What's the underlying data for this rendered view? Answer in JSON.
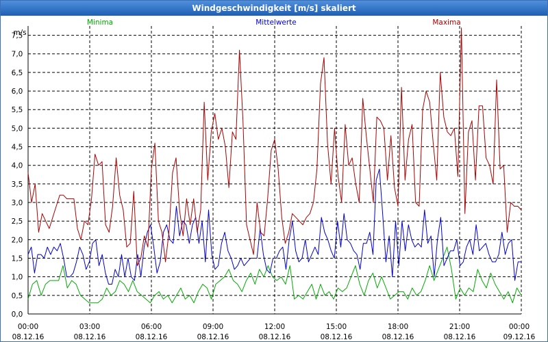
{
  "window": {
    "title": "Windgeschwindigkeit [m/s] skaliert"
  },
  "colors": {
    "title_bar": "#2b6cc4",
    "min": "#00aa00",
    "avg": "#0000cc",
    "max": "#aa0000",
    "grid": "#000000"
  },
  "chart_data": {
    "type": "line",
    "title": "Windgeschwindigkeit [m/s] skaliert",
    "ylabel": "m/s",
    "xlabel": "",
    "ylim": [
      0,
      7.75
    ],
    "y_ticks": [
      "0,0",
      "0,5",
      "1,0",
      "1,5",
      "2,0",
      "2,5",
      "3,0",
      "3,5",
      "4,0",
      "4,5",
      "5,0",
      "5,5",
      "6,0",
      "6,5",
      "7,0",
      "7,5"
    ],
    "x_range": [
      "2016-12-08 00:00",
      "2016-12-09 00:00"
    ],
    "x_ticks": [
      {
        "time": "00:00",
        "date": "08.12.16"
      },
      {
        "time": "03:00",
        "date": "08.12.16"
      },
      {
        "time": "06:00",
        "date": "08.12.16"
      },
      {
        "time": "09:00",
        "date": "08.12.16"
      },
      {
        "time": "12:00",
        "date": "08.12.16"
      },
      {
        "time": "15:00",
        "date": "08.12.16"
      },
      {
        "time": "18:00",
        "date": "08.12.16"
      },
      {
        "time": "21:00",
        "date": "08.12.16"
      },
      {
        "time": "00:00",
        "date": "09.12.16"
      }
    ],
    "grid": true,
    "x_interval_minutes": 15,
    "series": [
      {
        "name": "Minima",
        "color": "#00aa00",
        "values": [
          0.4,
          0.8,
          0.9,
          0.5,
          0.8,
          0.9,
          0.9,
          0.9,
          1.3,
          0.7,
          0.9,
          0.8,
          0.5,
          0.4,
          0.3,
          0.3,
          0.3,
          0.4,
          0.7,
          0.5,
          0.6,
          0.9,
          0.8,
          0.6,
          0.9,
          0.6,
          0.5,
          0.4,
          0.3,
          0.5,
          0.6,
          0.4,
          0.5,
          0.3,
          0.5,
          0.7,
          0.4,
          0.5,
          0.3,
          0.6,
          0.8,
          0.7,
          0.4,
          0.8,
          0.9,
          1.0,
          1.2,
          0.9,
          0.8,
          0.6,
          0.9,
          1.1,
          0.8,
          1.2,
          1.0,
          1.3,
          1.0,
          0.9,
          1.0,
          0.8,
          1.3,
          0.4,
          0.5,
          0.4,
          0.6,
          0.8,
          0.4,
          0.8,
          0.5,
          0.6,
          0.4,
          0.7,
          0.6,
          0.7,
          1.0,
          1.3,
          0.8,
          0.5,
          0.9,
          1.1,
          0.7,
          1.0,
          0.7,
          0.4,
          0.5,
          0.6,
          0.6,
          0.4,
          0.7,
          0.5,
          0.6,
          0.9,
          1.3,
          0.9,
          1.2,
          1.5,
          1.8,
          1.2,
          0.4,
          0.7,
          0.5,
          0.7,
          0.6,
          1.2,
          0.9,
          0.7,
          1.1,
          0.8,
          0.6,
          0.4,
          0.6,
          0.3,
          0.7,
          0.5
        ]
      },
      {
        "name": "Mittelwerte",
        "color": "#0000cc",
        "values": [
          1.6,
          1.8,
          1.1,
          1.6,
          1.6,
          1.5,
          1.8,
          1.6,
          1.8,
          1.7,
          1.9,
          1.5,
          1.0,
          1.0,
          1.1,
          1.4,
          1.8,
          1.6,
          1.2,
          1.4,
          1.9,
          2.0,
          1.3,
          1.6,
          1.1,
          0.8,
          0.8,
          1.2,
          1.0,
          1.6,
          1.0,
          1.5,
          1.0,
          0.9,
          1.6,
          1.0,
          1.8,
          2.2,
          2.4,
          1.8,
          1.1,
          1.4,
          2.2,
          2.4,
          2.0,
          1.9,
          2.9,
          2.1,
          2.5,
          2.4,
          1.9,
          2.4,
          2.6,
          1.9,
          2.5,
          1.4,
          2.8,
          1.6,
          1.2,
          1.3,
          1.9,
          2.2,
          1.7,
          1.5,
          1.2,
          1.3,
          1.5,
          1.3,
          1.4,
          1.5,
          1.5,
          1.5,
          2.3,
          1.6,
          1.2,
          1.1,
          1.5,
          1.5,
          1.7,
          1.8,
          1.2,
          2.0,
          2.5,
          1.7,
          1.4,
          1.5,
          2.0,
          1.4,
          1.6,
          1.8,
          1.6,
          2.6,
          2.2,
          2.0,
          1.7,
          1.5,
          2.5,
          1.8,
          2.7,
          2.0,
          1.9,
          1.7,
          1.6,
          1.2,
          1.9,
          1.9,
          2.2,
          1.6,
          3.6,
          3.9,
          2.7,
          1.4,
          2.1,
          1.0,
          2.5,
          1.3,
          2.5,
          1.7,
          2.4,
          2.0,
          1.8,
          1.9,
          1.8,
          2.8,
          1.9,
          2.1,
          1.0,
          2.0,
          2.6,
          1.3,
          1.5,
          1.7,
          1.7,
          2.0,
          1.3,
          1.4,
          1.8,
          2.0,
          1.6,
          2.4,
          1.7,
          1.8,
          1.9,
          1.6,
          1.4,
          1.4,
          1.6,
          2.2,
          1.6,
          1.9,
          2.0,
          0.9,
          1.4,
          1.4
        ]
      },
      {
        "name": "Maxima",
        "color": "#aa0000",
        "values": [
          3.8,
          3.0,
          3.5,
          2.2,
          2.7,
          2.5,
          2.3,
          2.6,
          2.9,
          3.2,
          3.2,
          3.1,
          3.1,
          3.1,
          2.3,
          2.0,
          2.5,
          2.4,
          3.1,
          4.3,
          4.0,
          4.1,
          2.4,
          2.2,
          2.9,
          4.2,
          3.2,
          2.8,
          1.8,
          1.9,
          3.3,
          1.3,
          1.5,
          2.1,
          1.8,
          3.9,
          4.6,
          2.5,
          2.2,
          1.4,
          2.2,
          3.8,
          4.2,
          2.8,
          2.1,
          3.1,
          2.4,
          3.1,
          2.2,
          2.8,
          5.7,
          3.6,
          4.9,
          5.4,
          4.7,
          5.0,
          4.5,
          3.4,
          4.9,
          4.7,
          7.1,
          5.2,
          2.4,
          2.0,
          1.6,
          3.0,
          2.2,
          2.1,
          3.1,
          4.4,
          4.7,
          3.9,
          2.6,
          1.9,
          2.2,
          2.7,
          2.6,
          2.5,
          2.4,
          2.6,
          2.7,
          3.0,
          3.9,
          6.2,
          6.9,
          4.6,
          3.5,
          5.0,
          3.7,
          3.0,
          5.1,
          4.0,
          4.2,
          3.5,
          3.0,
          5.8,
          4.8,
          3.9,
          3.0,
          5.3,
          5.2,
          5.0,
          3.6,
          4.8,
          3.4,
          2.9,
          6.1,
          3.6,
          4.7,
          5.1,
          3.0,
          2.9,
          5.5,
          6.0,
          5.7,
          4.6,
          3.6,
          6.5,
          5.3,
          4.9,
          4.8,
          5.0,
          3.7,
          7.7,
          2.7,
          4.9,
          5.2,
          3.6,
          5.6,
          5.6,
          4.2,
          4.0,
          3.5,
          6.3,
          3.9,
          4.0,
          2.2,
          3.0,
          2.9,
          2.9,
          2.8
        ]
      }
    ]
  }
}
